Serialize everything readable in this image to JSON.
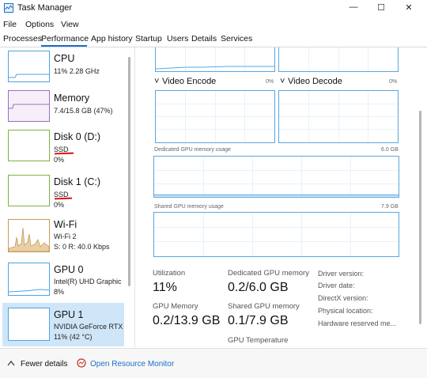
{
  "window": {
    "title": "Task Manager",
    "controls": {
      "minimize": "—",
      "maximize": "☐",
      "close": "✕"
    }
  },
  "menu": [
    "File",
    "Options",
    "View"
  ],
  "tabs": [
    "Processes",
    "Performance",
    "App history",
    "Startup",
    "Users",
    "Details",
    "Services"
  ],
  "left": {
    "cpu": {
      "name": "CPU",
      "sub": "11%  2.28 GHz"
    },
    "memory": {
      "name": "Memory",
      "sub": "7.4/15.8 GB (47%)"
    },
    "disk0": {
      "name": "Disk 0 (D:)",
      "type": "SSD",
      "usage": "0%"
    },
    "disk1": {
      "name": "Disk 1 (C:)",
      "type": "SSD",
      "usage": "0%"
    },
    "wifi": {
      "name": "Wi-Fi",
      "sub1": "Wi-Fi 2",
      "sub2": "S: 0  R: 40.0 Kbps"
    },
    "gpu0": {
      "name": "GPU 0",
      "sub1": "Intel(R) UHD Graphic",
      "sub2": "8%"
    },
    "gpu1": {
      "name": "GPU 1",
      "sub1": "NVIDIA GeForce RTX",
      "sub2": "11% (42 °C)"
    }
  },
  "right": {
    "video_encode": {
      "label": "Video Encode",
      "pct": "0%"
    },
    "video_decode": {
      "label": "Video Decode",
      "pct": "0%"
    },
    "dedicated": {
      "label": "Dedicated GPU memory usage",
      "max": "6.0 GB"
    },
    "shared": {
      "label": "Shared GPU memory usage",
      "max": "7.9 GB"
    },
    "stats": {
      "utilization": {
        "label": "Utilization",
        "value": "11%"
      },
      "dedicated_mem": {
        "label": "Dedicated GPU memory",
        "value": "0.2/6.0 GB"
      },
      "gpu_memory": {
        "label": "GPU Memory",
        "value": "0.2/13.9 GB"
      },
      "shared_mem": {
        "label": "Shared GPU memory",
        "value": "0.1/7.9 GB"
      },
      "gpu_temp": {
        "label": "GPU Temperature"
      }
    },
    "info": [
      "Driver version:",
      "Driver date:",
      "DirectX version:",
      "Physical location:",
      "Hardware reserved me..."
    ]
  },
  "footer": {
    "fewer": "Fewer details",
    "monitor": "Open Resource Monitor"
  },
  "colors": {
    "accent": "#1a6fc7",
    "graph_border": "#5aa7e0",
    "cpu": "#4fa3e0",
    "memory": "#9b6fbf",
    "disk": "#7fb046",
    "wifi": "#c89a5a",
    "selected": "#cfe6f8",
    "underline_red": "#d11111"
  }
}
